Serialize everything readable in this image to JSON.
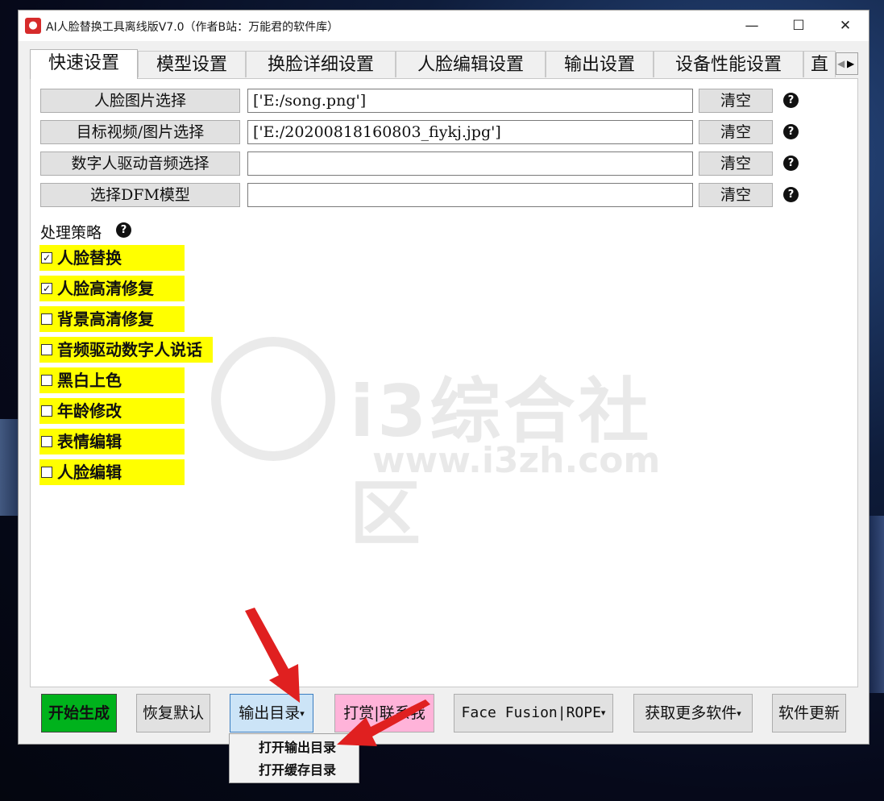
{
  "window": {
    "title": "AI人脸替换工具离线版V7.0（作者B站：万能君的软件库）",
    "icon": "app-logo-icon",
    "minimize_glyph": "—",
    "maximize_glyph": "☐",
    "close_glyph": "✕"
  },
  "tabs": [
    {
      "label": "快速设置",
      "active": true
    },
    {
      "label": "模型设置"
    },
    {
      "label": "换脸详细设置"
    },
    {
      "label": "人脸编辑设置"
    },
    {
      "label": "输出设置"
    },
    {
      "label": "设备性能设置"
    },
    {
      "label": "直"
    }
  ],
  "tab_scroll": {
    "left": "◀",
    "right": "▶"
  },
  "file_rows": [
    {
      "button": "人脸图片选择",
      "value": "['E:/song.png']",
      "clear": "清空"
    },
    {
      "button": "目标视频/图片选择",
      "value": "['E:/20200818160803_fiykj.jpg']",
      "clear": "清空"
    },
    {
      "button": "数字人驱动音频选择",
      "value": "",
      "clear": "清空"
    },
    {
      "button": "选择DFM模型",
      "value": "",
      "clear": "清空"
    }
  ],
  "help_glyph": "?",
  "strategy": {
    "label": "处理策略",
    "options": [
      {
        "label": "人脸替换",
        "checked": true
      },
      {
        "label": "人脸高清修复",
        "checked": true
      },
      {
        "label": "背景高清修复",
        "checked": false
      },
      {
        "label": "音频驱动数字人说话",
        "checked": false
      },
      {
        "label": "黑白上色",
        "checked": false
      },
      {
        "label": "年龄修改",
        "checked": false
      },
      {
        "label": "表情编辑",
        "checked": false
      },
      {
        "label": "人脸编辑",
        "checked": false
      }
    ],
    "check_mark": "✓"
  },
  "watermark": {
    "text": "i3综合社区",
    "url": "www.i3zh.com"
  },
  "bottom_buttons": {
    "start": "开始生成",
    "restore": "恢复默认",
    "output": "输出目录",
    "donate": "打赏|联系我",
    "fusion": "Face Fusion|ROPE",
    "more": "获取更多软件",
    "update": "软件更新",
    "caret": "▾"
  },
  "dropdown": {
    "items": [
      "打开输出目录",
      "打开缓存目录"
    ]
  },
  "colors": {
    "start_green": "#00b21c",
    "highlight_yellow": "#ffff00",
    "donate_pink": "#ffb3d9",
    "output_blue": "#cce4f7",
    "arrow_red": "#e02020"
  }
}
